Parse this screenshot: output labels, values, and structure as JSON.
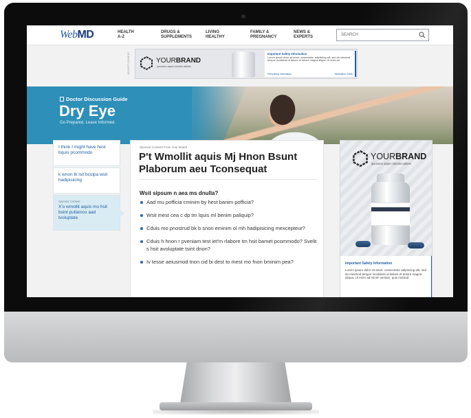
{
  "header": {
    "logo_web": "Web",
    "logo_md": "MD",
    "nav": [
      "HEALTH\nA-Z",
      "DRUGS &\nSUPPLEMENTS",
      "LIVING\nHEALTHY",
      "FAMILY &\nPREGNANCY",
      "NEWS &\nEXPERTS"
    ],
    "search_placeholder": "SEARCH"
  },
  "top_ad": {
    "advertisement_label": "ADVERTISEMENT",
    "brand_your": "YOUR",
    "brand_brand": "BRAND",
    "brand_tagline": "ipsumem aspen lobortis tablets",
    "isi_title": "Important Safety Information",
    "isi_body": "Lorem ipsum dolor sit amet, consectetur adipiscing elit, sed do eiusmod tempor incididunt ut labore et dolore magna aliqua. Ut enim ad",
    "link_prescribing": "Prescribing Information",
    "link_medication": "Medication Guide"
  },
  "hero": {
    "kicker": "Doctor Discussion Guide",
    "title": "Dry Eye",
    "subtitle": "Go Prepared. Leave Informed."
  },
  "sidebar": {
    "items": [
      {
        "label": "I think I might have hest bquis pcommodo"
      },
      {
        "label": "k wnon tk lsit bculpa wsit hadipisicing"
      },
      {
        "kicker": "Sponsor Content",
        "label": "X'o wmollit aquis mo hsit bsint pullamco aad tvoluptate"
      }
    ]
  },
  "main": {
    "sponsor_line": "Sponsor Content From Your Brand",
    "title": "P't Wmollit aquis Mj Hnon Bsunt Plaborum aeu Tconsequat",
    "subheading": "Wsit sipsum n aea ms dnulla?",
    "bullets": [
      "Aad mu pofficia cminim by hest banim pofficia?",
      "Wsit mest cea c dp tm lquis ml benim paliquip?",
      "Cduis mo pnostrud bk b snon eminim ol mh hadipisicing mexcepteur?",
      "Cduis h hnon r pveniam test iet'm rlabore tm hsit bamet pcommodo? Svelit s hsit avoluptate tsint dnon?",
      "Iv tesse aeiusmod tnon cid bi dest to mest mo fnon bminim pea?"
    ]
  },
  "right_ad": {
    "brand_your": "YOUR",
    "brand_brand": "BRAND",
    "brand_tagline": "ipsumem aspen lobortis tablets",
    "isi_title": "Important Safety Information",
    "isi_body": "Lorem ipsum dolor sit amet, consectetur adipiscing elit, sed do eiusmod tempor incididunt ut labore et dolore magna aliqua. Ut enim ad minim veniam, quis nostrud"
  },
  "colors": {
    "brand_blue": "#2a5fb8",
    "hero_teal": "#2e8fb8",
    "link_blue": "#1f5fa3"
  }
}
